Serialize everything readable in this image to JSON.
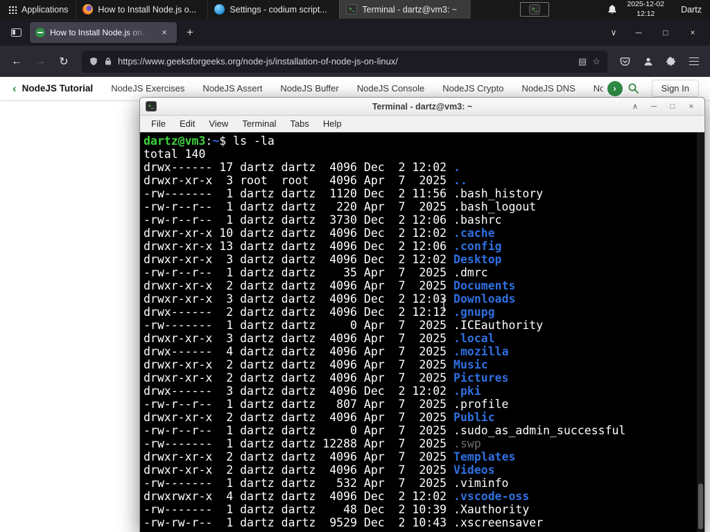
{
  "colors": {
    "terminal_green": "#3dd33d",
    "terminal_directory_blue": "#2e6fe0",
    "terminal_dim": "#6e6e6e",
    "gfg_green": "#2f8d46"
  },
  "icons": {
    "back": "←",
    "forward": "→",
    "reload": "↻",
    "reader": "▤",
    "star": "☆",
    "list_tabs": "∨",
    "new_tab": "+",
    "tab_close": "×",
    "win_minimize": "─",
    "win_maximize": "□",
    "win_close": "×",
    "term_shade": "∧",
    "term_minimize": "─",
    "term_maximize": "□",
    "term_close": "×",
    "nav_back": "‹",
    "nav_forward": "›",
    "terminal_glyph": ">_"
  },
  "system_bar": {
    "applications_label": "Applications",
    "taskbar_items": [
      {
        "title": "How to Install Node.js o...",
        "icon": "firefox-icon"
      },
      {
        "title": "Settings - codium script...",
        "icon": "settings-icon"
      },
      {
        "title": "Terminal - dartz@vm3: ~",
        "icon": "terminal-icon"
      }
    ],
    "clock_date": "2025-12-02",
    "clock_time": "12:12",
    "user_label": "Dartz"
  },
  "browser": {
    "tab_title": "How to Install Node.js on...",
    "url": "https://www.geeksforgeeks.org/node-js/installation-of-node-js-on-linux/"
  },
  "gfg_nav": {
    "items": [
      "NodeJS Tutorial",
      "NodeJS Exercises",
      "NodeJS Assert",
      "NodeJS Buffer",
      "NodeJS Console",
      "NodeJS Crypto",
      "NodeJS DNS",
      "Node"
    ],
    "sign_in_label": "Sign In"
  },
  "terminal": {
    "title": "Terminal - dartz@vm3: ~",
    "menu_items": [
      "File",
      "Edit",
      "View",
      "Terminal",
      "Tabs",
      "Help"
    ],
    "prompt_user_host": "dartz@vm3",
    "prompt_path": "~",
    "prompt_suffix": "$",
    "command": "ls -la",
    "total_line": "total 140",
    "entries": [
      {
        "perms": "drwx------",
        "links": 17,
        "owner": "dartz",
        "group": "dartz",
        "size": 4096,
        "month": "Dec",
        "day": 2,
        "time": "12:02",
        "name": ".",
        "type": "dir"
      },
      {
        "perms": "drwxr-xr-x",
        "links": 3,
        "owner": "root",
        "group": "root",
        "size": 4096,
        "month": "Apr",
        "day": 7,
        "time": "2025",
        "name": "..",
        "type": "dir"
      },
      {
        "perms": "-rw-------",
        "links": 1,
        "owner": "dartz",
        "group": "dartz",
        "size": 1120,
        "month": "Dec",
        "day": 2,
        "time": "11:56",
        "name": ".bash_history",
        "type": "file"
      },
      {
        "perms": "-rw-r--r--",
        "links": 1,
        "owner": "dartz",
        "group": "dartz",
        "size": 220,
        "month": "Apr",
        "day": 7,
        "time": "2025",
        "name": ".bash_logout",
        "type": "file"
      },
      {
        "perms": "-rw-r--r--",
        "links": 1,
        "owner": "dartz",
        "group": "dartz",
        "size": 3730,
        "month": "Dec",
        "day": 2,
        "time": "12:06",
        "name": ".bashrc",
        "type": "file"
      },
      {
        "perms": "drwxr-xr-x",
        "links": 10,
        "owner": "dartz",
        "group": "dartz",
        "size": 4096,
        "month": "Dec",
        "day": 2,
        "time": "12:02",
        "name": ".cache",
        "type": "dir"
      },
      {
        "perms": "drwxr-xr-x",
        "links": 13,
        "owner": "dartz",
        "group": "dartz",
        "size": 4096,
        "month": "Dec",
        "day": 2,
        "time": "12:06",
        "name": ".config",
        "type": "dir"
      },
      {
        "perms": "drwxr-xr-x",
        "links": 3,
        "owner": "dartz",
        "group": "dartz",
        "size": 4096,
        "month": "Dec",
        "day": 2,
        "time": "12:02",
        "name": "Desktop",
        "type": "dir"
      },
      {
        "perms": "-rw-r--r--",
        "links": 1,
        "owner": "dartz",
        "group": "dartz",
        "size": 35,
        "month": "Apr",
        "day": 7,
        "time": "2025",
        "name": ".dmrc",
        "type": "file"
      },
      {
        "perms": "drwxr-xr-x",
        "links": 2,
        "owner": "dartz",
        "group": "dartz",
        "size": 4096,
        "month": "Apr",
        "day": 7,
        "time": "2025",
        "name": "Documents",
        "type": "dir"
      },
      {
        "perms": "drwxr-xr-x",
        "links": 3,
        "owner": "dartz",
        "group": "dartz",
        "size": 4096,
        "month": "Dec",
        "day": 2,
        "time": "12:03",
        "name": "Downloads",
        "type": "dir"
      },
      {
        "perms": "drwx------",
        "links": 2,
        "owner": "dartz",
        "group": "dartz",
        "size": 4096,
        "month": "Dec",
        "day": 2,
        "time": "12:12",
        "name": ".gnupg",
        "type": "dir"
      },
      {
        "perms": "-rw-------",
        "links": 1,
        "owner": "dartz",
        "group": "dartz",
        "size": 0,
        "month": "Apr",
        "day": 7,
        "time": "2025",
        "name": ".ICEauthority",
        "type": "file"
      },
      {
        "perms": "drwxr-xr-x",
        "links": 3,
        "owner": "dartz",
        "group": "dartz",
        "size": 4096,
        "month": "Apr",
        "day": 7,
        "time": "2025",
        "name": ".local",
        "type": "dir"
      },
      {
        "perms": "drwx------",
        "links": 4,
        "owner": "dartz",
        "group": "dartz",
        "size": 4096,
        "month": "Apr",
        "day": 7,
        "time": "2025",
        "name": ".mozilla",
        "type": "dir"
      },
      {
        "perms": "drwxr-xr-x",
        "links": 2,
        "owner": "dartz",
        "group": "dartz",
        "size": 4096,
        "month": "Apr",
        "day": 7,
        "time": "2025",
        "name": "Music",
        "type": "dir"
      },
      {
        "perms": "drwxr-xr-x",
        "links": 2,
        "owner": "dartz",
        "group": "dartz",
        "size": 4096,
        "month": "Apr",
        "day": 7,
        "time": "2025",
        "name": "Pictures",
        "type": "dir"
      },
      {
        "perms": "drwx------",
        "links": 3,
        "owner": "dartz",
        "group": "dartz",
        "size": 4096,
        "month": "Dec",
        "day": 2,
        "time": "12:02",
        "name": ".pki",
        "type": "dir"
      },
      {
        "perms": "-rw-r--r--",
        "links": 1,
        "owner": "dartz",
        "group": "dartz",
        "size": 807,
        "month": "Apr",
        "day": 7,
        "time": "2025",
        "name": ".profile",
        "type": "file"
      },
      {
        "perms": "drwxr-xr-x",
        "links": 2,
        "owner": "dartz",
        "group": "dartz",
        "size": 4096,
        "month": "Apr",
        "day": 7,
        "time": "2025",
        "name": "Public",
        "type": "dir"
      },
      {
        "perms": "-rw-r--r--",
        "links": 1,
        "owner": "dartz",
        "group": "dartz",
        "size": 0,
        "month": "Apr",
        "day": 7,
        "time": "2025",
        "name": ".sudo_as_admin_successful",
        "type": "file"
      },
      {
        "perms": "-rw-------",
        "links": 1,
        "owner": "dartz",
        "group": "dartz",
        "size": 12288,
        "month": "Apr",
        "day": 7,
        "time": "2025",
        "name": ".swp",
        "type": "dim"
      },
      {
        "perms": "drwxr-xr-x",
        "links": 2,
        "owner": "dartz",
        "group": "dartz",
        "size": 4096,
        "month": "Apr",
        "day": 7,
        "time": "2025",
        "name": "Templates",
        "type": "dir"
      },
      {
        "perms": "drwxr-xr-x",
        "links": 2,
        "owner": "dartz",
        "group": "dartz",
        "size": 4096,
        "month": "Apr",
        "day": 7,
        "time": "2025",
        "name": "Videos",
        "type": "dir"
      },
      {
        "perms": "-rw-------",
        "links": 1,
        "owner": "dartz",
        "group": "dartz",
        "size": 532,
        "month": "Apr",
        "day": 7,
        "time": "2025",
        "name": ".viminfo",
        "type": "file"
      },
      {
        "perms": "drwxrwxr-x",
        "links": 4,
        "owner": "dartz",
        "group": "dartz",
        "size": 4096,
        "month": "Dec",
        "day": 2,
        "time": "12:02",
        "name": ".vscode-oss",
        "type": "dir"
      },
      {
        "perms": "-rw-------",
        "links": 1,
        "owner": "dartz",
        "group": "dartz",
        "size": 48,
        "month": "Dec",
        "day": 2,
        "time": "10:39",
        "name": ".Xauthority",
        "type": "file"
      },
      {
        "perms": "-rw-rw-r--",
        "links": 1,
        "owner": "dartz",
        "group": "dartz",
        "size": 9529,
        "month": "Dec",
        "day": 2,
        "time": "10:43",
        "name": ".xscreensaver",
        "type": "file"
      }
    ]
  }
}
